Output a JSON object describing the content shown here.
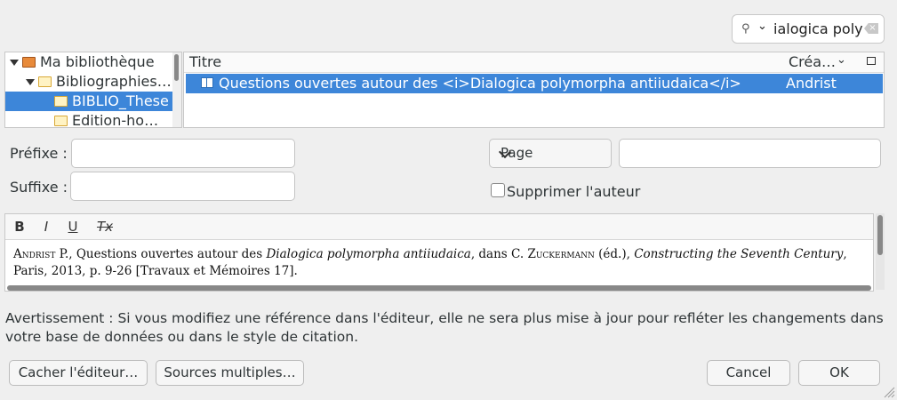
{
  "search": {
    "value": "ialogica poly"
  },
  "tree": {
    "items": [
      {
        "label": "Ma bibliothèque"
      },
      {
        "label": "Bibliographies…"
      },
      {
        "label": "BIBLIO_These"
      },
      {
        "label": "Edition-ho…"
      }
    ]
  },
  "items": {
    "columns": {
      "title": "Titre",
      "creator": "Créa…"
    },
    "rows": [
      {
        "title": "Questions ouvertes autour des <i>Dialogica polymorpha antiiudaica</i>",
        "creator": "Andrist"
      }
    ]
  },
  "fields": {
    "prefix_label": "Préfixe :",
    "suffix_label": "Suffixe :",
    "locator_selected": "Page",
    "suppress_author_label": "Supprimer l'auteur"
  },
  "editor": {
    "toolbar": {
      "bold": "B",
      "italic": "I",
      "underline": "U",
      "clear": "Tx"
    },
    "citation": {
      "author": "Andrist",
      "p1": " P., Questions ouvertes autour des ",
      "title_italic": "Dialogica polymorpha antiiudaica",
      "p2": ", dans C. ",
      "editor_name": "Zuckermann",
      "p3": " (éd.), ",
      "book_italic": "Constructing the Seventh Century",
      "p4": ", Paris, 2013, p. 9-26 [Travaux et Mémoires 17]."
    }
  },
  "warning": "Avertissement : Si vous modifiez une référence dans l'éditeur, elle ne sera plus mise à jour pour refléter les changements dans votre base de données ou dans le style de citation.",
  "buttons": {
    "hide_editor": "Cacher l'éditeur…",
    "multiple_sources": "Sources multiples…",
    "cancel": "Cancel",
    "ok": "OK"
  }
}
